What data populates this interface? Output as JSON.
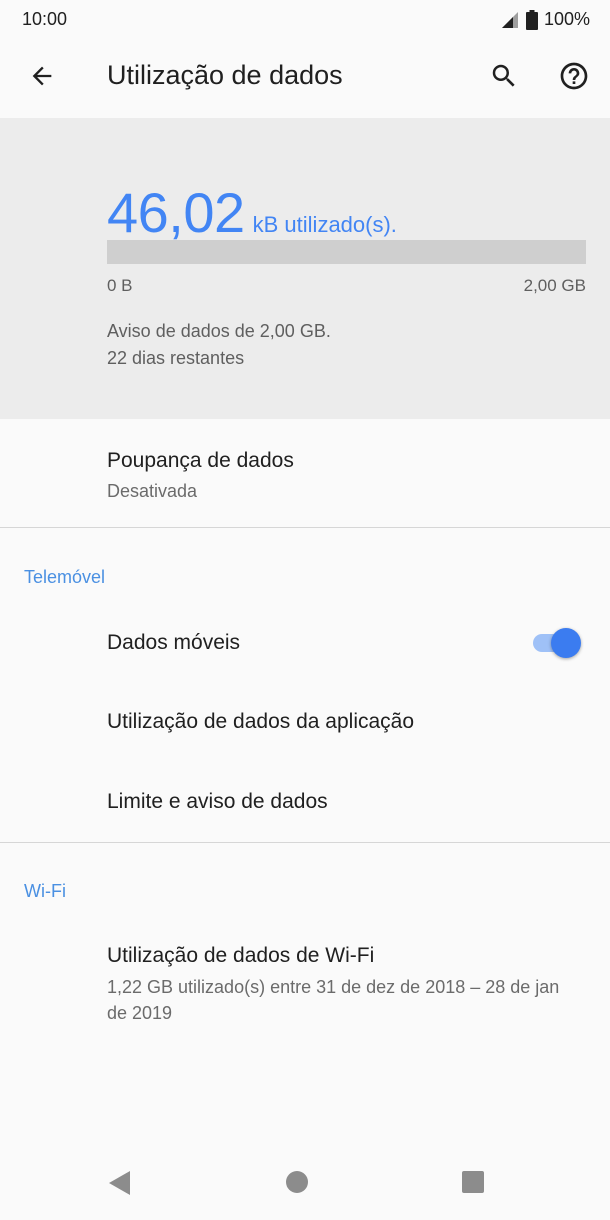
{
  "status_bar": {
    "time": "10:00",
    "battery": "100%",
    "icons": [
      "signal-icon",
      "battery-icon"
    ]
  },
  "toolbar": {
    "title": "Utilização de dados",
    "icons": [
      "back-arrow-icon",
      "search-icon",
      "help-icon"
    ]
  },
  "usage": {
    "amount": "46,02",
    "unit": "kB utilizado(s).",
    "bar_min_label": "0 B",
    "bar_max_label": "2,00 GB",
    "bar_fill_fraction": 0.0,
    "warning": "Aviso de dados de 2,00 GB.",
    "days_left": "22 dias restantes",
    "accent_color": "#4285f4"
  },
  "data_saver": {
    "title": "Poupança de dados",
    "status": "Desativada"
  },
  "mobile_section": {
    "header": "Telemóvel",
    "items": [
      {
        "label": "Dados móveis",
        "toggle_on": true
      },
      {
        "label": "Utilização de dados da aplicação"
      },
      {
        "label": "Limite e aviso de dados"
      }
    ]
  },
  "wifi_section": {
    "header": "Wi-Fi",
    "items": [
      {
        "label": "Utilização de dados de Wi-Fi",
        "subtitle": "1,22 GB utilizado(s) entre 31 de dez de 2018 – 28 de jan de 2019"
      }
    ]
  },
  "nav_bar": {
    "icons": [
      "nav-back-icon",
      "nav-home-icon",
      "nav-recents-icon"
    ]
  }
}
